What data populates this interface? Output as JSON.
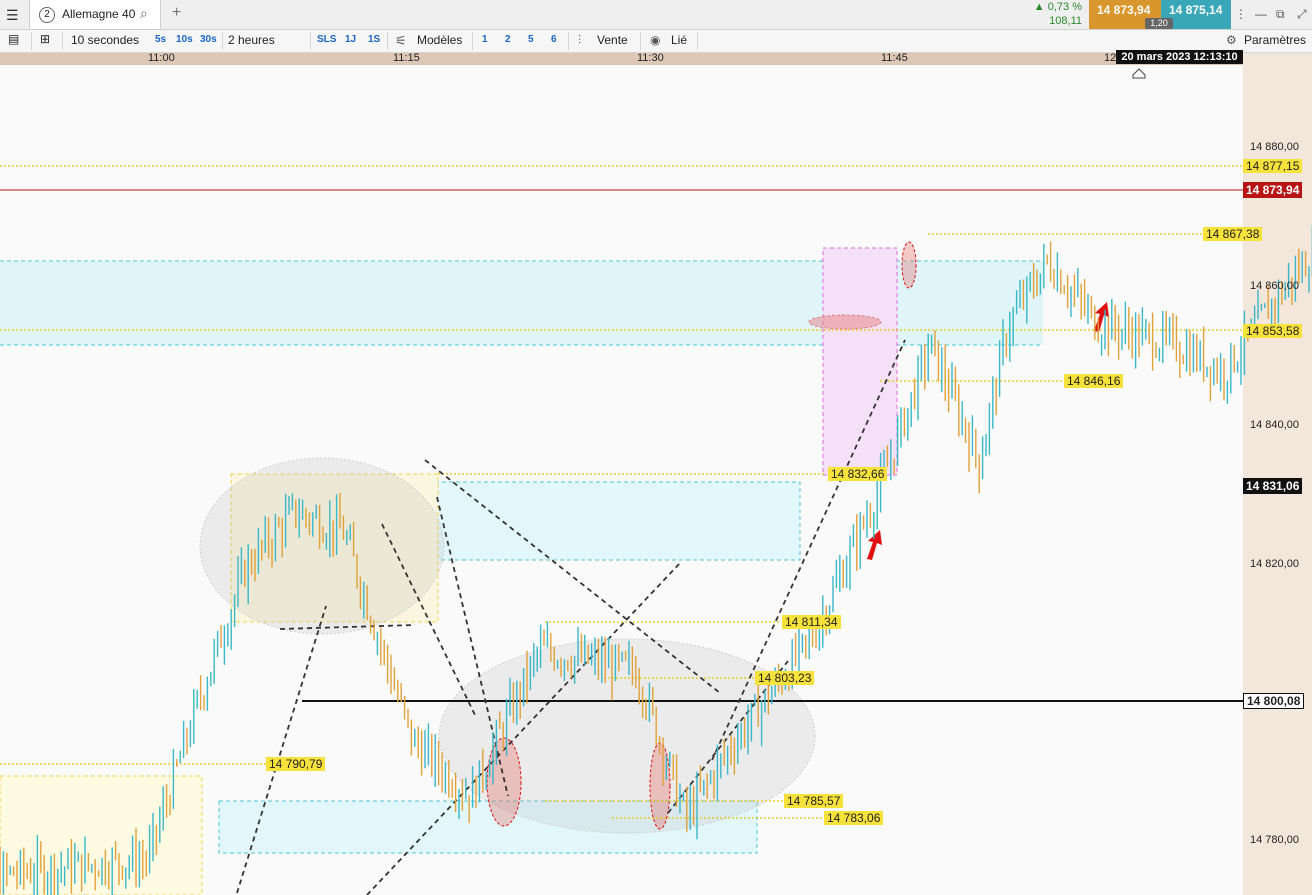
{
  "tab": {
    "number": "2",
    "title": "Allemagne 40"
  },
  "quote": {
    "change_pct": "▲ 0,73 %",
    "change_pts": "108,11",
    "bid": "14 873,94",
    "ask": "14 875,14",
    "spread": "1,20"
  },
  "toolbar": {
    "interval": "10 secondes",
    "intervals": [
      "5s",
      "10s",
      "30s"
    ],
    "duration": "2 heures",
    "ranges": [
      "SLS",
      "1J",
      "1S"
    ],
    "models_label": "Modèles",
    "pages": [
      "1",
      "2",
      "5",
      "6"
    ],
    "sell_label": "Vente",
    "linked_label": "Lié",
    "settings_label": "Paramètres"
  },
  "time_axis": {
    "labels": [
      "11:00",
      "11:15",
      "11:30",
      "11:45",
      "12"
    ],
    "current_date": "20 mars 2023 12:13:10"
  },
  "price_axis": {
    "labels": [
      "14 880,00",
      "14 860,00",
      "14 840,00",
      "14 820,00",
      "14 780,00"
    ]
  },
  "price_tags": {
    "last": "14 873,94",
    "t_877": "14 877,15",
    "t_867": "14 867,38",
    "t_853": "14 853,58",
    "t_846": "14 846,16",
    "t_832": "14 832,66",
    "t_831": "14 831,06",
    "t_811": "14 811,34",
    "t_803": "14 803,23",
    "t_800": "14 800,08",
    "t_790": "14 790,79",
    "t_785": "14 785,57",
    "t_783": "14 783,06"
  },
  "colors": {
    "bull": "#3ab7c8",
    "bear": "#e0a13a",
    "last_price": "#b81414",
    "tag_yellow": "#f7e13b",
    "axis_bg": "#f3e6db"
  },
  "chart_data": {
    "type": "bar",
    "instrument": "Allemagne 40",
    "timeframe": "10 secondes",
    "x_ticks": [
      "11:00",
      "11:15",
      "11:30",
      "11:45",
      "12"
    ],
    "ylim": [
      14775,
      14890
    ],
    "levels": [
      14877.15,
      14873.94,
      14867.38,
      14853.58,
      14846.16,
      14832.66,
      14831.06,
      14811.34,
      14803.23,
      14800.08,
      14790.79,
      14785.57,
      14783.06
    ],
    "approx_path": [
      [
        10.8,
        14775
      ],
      [
        11.0,
        14778
      ],
      [
        11.05,
        14800
      ],
      [
        11.1,
        14820
      ],
      [
        11.15,
        14828
      ],
      [
        11.2,
        14825
      ],
      [
        11.27,
        14795
      ],
      [
        11.33,
        14787
      ],
      [
        11.4,
        14808
      ],
      [
        11.5,
        14805
      ],
      [
        11.55,
        14784
      ],
      [
        11.6,
        14795
      ],
      [
        11.68,
        14810
      ],
      [
        11.75,
        14832
      ],
      [
        11.8,
        14852
      ],
      [
        11.85,
        14835
      ],
      [
        11.88,
        14855
      ],
      [
        11.92,
        14864
      ],
      [
        11.97,
        14855
      ],
      [
        12.05,
        14852
      ],
      [
        12.1,
        14848
      ],
      [
        12.15,
        14858
      ],
      [
        12.22,
        14870
      ],
      [
        12.25,
        14877
      ],
      [
        12.28,
        14874
      ]
    ]
  }
}
